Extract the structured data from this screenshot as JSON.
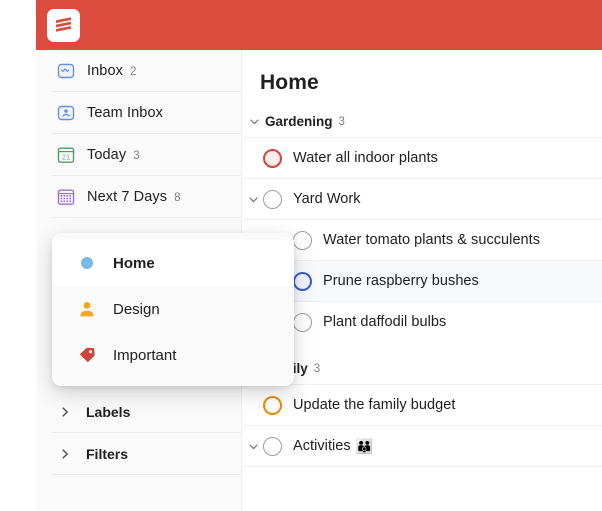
{
  "app": {
    "brand_color": "#db4c3f",
    "logo_icon": "todoist-logo-icon",
    "sidebar_bg": "#fafafa"
  },
  "sidebar": {
    "items": [
      {
        "label": "Inbox",
        "count": "2",
        "icon": "inbox-icon",
        "icon_color": "#6a8fe0"
      },
      {
        "label": "Team Inbox",
        "count": "",
        "icon": "team-inbox-icon",
        "icon_color": "#6a8fe0"
      },
      {
        "label": "Today",
        "count": "3",
        "icon": "calendar-today-icon",
        "icon_color": "#4c9a64"
      },
      {
        "label": "Next 7 Days",
        "count": "8",
        "icon": "calendar-week-icon",
        "icon_color": "#9a6ed1"
      }
    ],
    "collapsibles": [
      {
        "label": "Labels",
        "icon": "chevron-right-icon"
      },
      {
        "label": "Filters",
        "icon": "chevron-right-icon"
      }
    ]
  },
  "overlay": {
    "items": [
      {
        "label": "Home",
        "icon": "blue-dot-icon",
        "icon_color": "#7ab8e8",
        "active": true
      },
      {
        "label": "Design",
        "icon": "person-icon",
        "icon_color": "#f5a623",
        "active": false
      },
      {
        "label": "Important",
        "icon": "tag-icon",
        "icon_color": "#d1453b",
        "active": false
      }
    ]
  },
  "main": {
    "title": "Home",
    "sections": [
      {
        "name": "Gardening",
        "count": "3",
        "chevron": "chevron-down-icon",
        "tasks": [
          {
            "label": "Water all indoor plants",
            "checkbox": "red",
            "chevron": "",
            "indent": 0,
            "selected": false,
            "emoji": ""
          },
          {
            "label": "Yard Work",
            "checkbox": "plain",
            "chevron": "chevron-down-icon",
            "indent": 0,
            "selected": false,
            "emoji": ""
          },
          {
            "label": "Water tomato plants & succulents",
            "checkbox": "plain",
            "chevron": "",
            "indent": 1,
            "selected": false,
            "emoji": ""
          },
          {
            "label": "Prune raspberry bushes",
            "checkbox": "blue",
            "chevron": "",
            "indent": 1,
            "selected": true,
            "emoji": ""
          },
          {
            "label": "Plant daffodil bulbs",
            "checkbox": "plain",
            "chevron": "",
            "indent": 1,
            "selected": false,
            "emoji": ""
          }
        ]
      },
      {
        "name": "Family",
        "count": "3",
        "chevron": "chevron-down-icon",
        "tasks": [
          {
            "label": "Update the family budget",
            "checkbox": "amber",
            "chevron": "",
            "indent": 0,
            "selected": false,
            "emoji": ""
          },
          {
            "label": "Activities",
            "checkbox": "plain",
            "chevron": "chevron-down-icon",
            "indent": 0,
            "selected": false,
            "emoji": "👪"
          }
        ]
      }
    ]
  }
}
